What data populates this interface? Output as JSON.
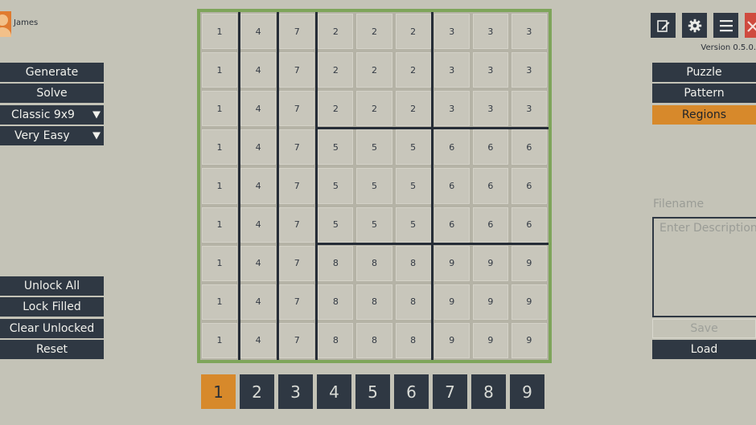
{
  "user": {
    "name": "James"
  },
  "left_panel": {
    "generate_label": "Generate",
    "solve_label": "Solve",
    "variant_select": "Classic 9x9",
    "difficulty_select": "Very Easy",
    "unlock_all_label": "Unlock All",
    "lock_filled_label": "Lock Filled",
    "clear_unlocked_label": "Clear Unlocked",
    "reset_label": "Reset"
  },
  "board": {
    "rows": [
      [
        "1",
        "4",
        "7",
        "2",
        "2",
        "2",
        "3",
        "3",
        "3"
      ],
      [
        "1",
        "4",
        "7",
        "2",
        "2",
        "2",
        "3",
        "3",
        "3"
      ],
      [
        "1",
        "4",
        "7",
        "2",
        "2",
        "2",
        "3",
        "3",
        "3"
      ],
      [
        "1",
        "4",
        "7",
        "5",
        "5",
        "5",
        "6",
        "6",
        "6"
      ],
      [
        "1",
        "4",
        "7",
        "5",
        "5",
        "5",
        "6",
        "6",
        "6"
      ],
      [
        "1",
        "4",
        "7",
        "5",
        "5",
        "5",
        "6",
        "6",
        "6"
      ],
      [
        "1",
        "4",
        "7",
        "8",
        "8",
        "8",
        "9",
        "9",
        "9"
      ],
      [
        "1",
        "4",
        "7",
        "8",
        "8",
        "8",
        "9",
        "9",
        "9"
      ],
      [
        "1",
        "4",
        "7",
        "8",
        "8",
        "8",
        "9",
        "9",
        "9"
      ]
    ],
    "border_color": "#7ea55a"
  },
  "number_pad": {
    "numbers": [
      "1",
      "2",
      "3",
      "4",
      "5",
      "6",
      "7",
      "8",
      "9"
    ],
    "selected": "1"
  },
  "top_right": {
    "icons": [
      "edit-icon",
      "gear-icon",
      "menu-icon",
      "close-icon"
    ],
    "version": "Version 0.5.0."
  },
  "right_panel": {
    "puzzle_label": "Puzzle",
    "pattern_label": "Pattern",
    "regions_label": "Regions",
    "active_tab": "Regions",
    "filename_label": "Filename",
    "description_placeholder": "Enter Description",
    "save_label": "Save",
    "load_label": "Load"
  },
  "colors": {
    "background": "#c4c3b7",
    "button": "#2f3843",
    "accent": "#d7892b",
    "close": "#cf4a3e"
  }
}
